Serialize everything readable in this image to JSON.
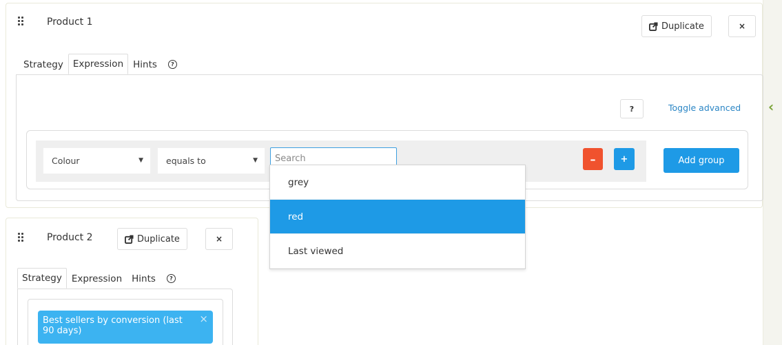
{
  "product1": {
    "title": "Product 1",
    "duplicate_label": "Duplicate",
    "close_label": "×",
    "tabs": [
      {
        "label": "Strategy"
      },
      {
        "label": "Expression"
      },
      {
        "label": "Hints"
      }
    ],
    "help_icon": "?",
    "question_label": "?",
    "toggle_advanced": "Toggle advanced",
    "rule": {
      "attribute": "Colour",
      "operator": "equals to",
      "search_placeholder": "Search",
      "minus_label": "–",
      "plus_label": "+",
      "add_group_label": "Add group"
    }
  },
  "dropdown": {
    "options": [
      {
        "label": "grey"
      },
      {
        "label": "red"
      },
      {
        "label": "Last viewed"
      }
    ],
    "highlighted": "red"
  },
  "product2": {
    "title": "Product 2",
    "duplicate_label": "Duplicate",
    "close_label": "×",
    "tabs": [
      {
        "label": "Strategy"
      },
      {
        "label": "Expression"
      },
      {
        "label": "Hints"
      }
    ],
    "help_icon": "?",
    "strategy_tag": "Best sellers by conversion (last 90 days)",
    "strategy_tag_close": "×"
  },
  "sidebar": {
    "collapse_icon": "chevron-left-icon"
  },
  "colors": {
    "accent_blue": "#1e9ae6",
    "danger_orange": "#f0522e",
    "tag_blue": "#3cb3f1",
    "link_blue": "#2b86c5",
    "chevron_green": "#7aa337"
  }
}
